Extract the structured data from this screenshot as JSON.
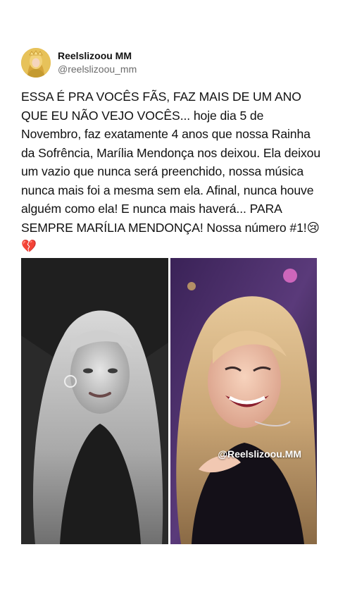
{
  "post": {
    "display_name": "Reelslizoou MM",
    "handle": "@reelslizoou_mm",
    "text": "ESSA É PRA VOCÊS FÃS, FAZ MAIS DE UM ANO QUE EU NÃO VEJO VOCÊS... hoje dia 5 de Novembro, faz exatamente 4 anos que nossa Rainha da Sofrência, Marília Mendonça nos deixou. Ela deixou um vazio que nunca será preenchido, nossa música nunca mais foi a mesma sem ela. Afinal, nunca houve alguém como ela! E nunca mais haverá... PARA SEMPRE MARÍLIA MENDONÇA! Nossa número #1!😢💔"
  },
  "media": {
    "watermark": "@Reelslizoou.MM",
    "left_photo_icon": "black-and-white-portrait",
    "right_photo_icon": "smiling-woman-portrait"
  }
}
